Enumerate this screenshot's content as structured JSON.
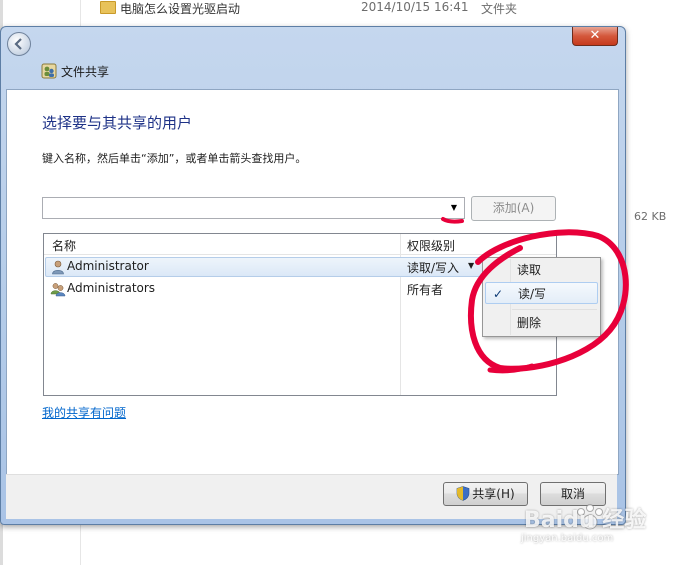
{
  "background": {
    "row_name": "电脑怎么设置光驱启动",
    "row_date": "2014/10/15 16:41",
    "row_type": "文件夹",
    "size_text": "62 KB"
  },
  "dialog": {
    "close_label": "✕",
    "title": "文件共享",
    "heading": "选择要与其共享的用户",
    "instruction": "键入名称，然后单击“添加”，或者单击箭头查找用户。",
    "combo_value": "",
    "add_label": "添加(A)",
    "columns": {
      "name": "名称",
      "permission": "权限级别"
    },
    "rows": [
      {
        "name": "Administrator",
        "permission": "读取/写入"
      },
      {
        "name": "Administrators",
        "permission": "所有者"
      }
    ],
    "menu": {
      "read": "读取",
      "readwrite": "读/写",
      "check": "✓",
      "remove": "删除"
    },
    "help_link": "我的共享有问题",
    "share_label": "共享(H)",
    "cancel_label": "取消"
  },
  "watermark": {
    "brand": "Baidu 经验",
    "url": "jingyan.baidu.com"
  },
  "colors": {
    "heading": "#1e3287",
    "link": "#0066cc",
    "annotation": "#e8003a"
  }
}
